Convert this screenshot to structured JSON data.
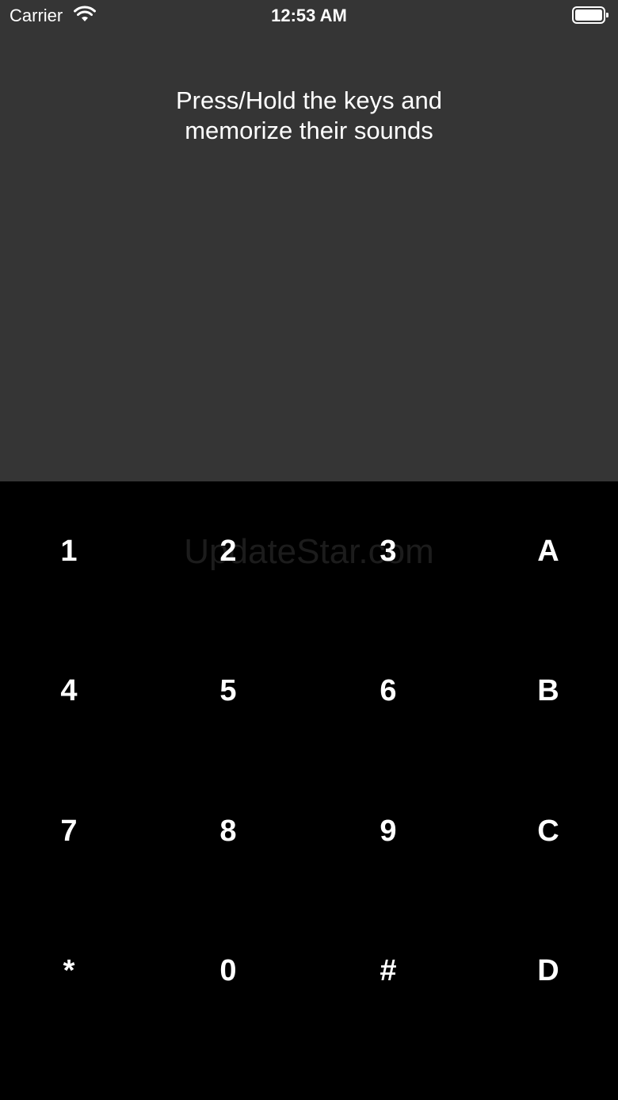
{
  "status_bar": {
    "carrier": "Carrier",
    "time": "12:53 AM",
    "wifi_icon": "wifi-icon",
    "battery_icon": "battery-icon"
  },
  "instruction": {
    "line1": "Press/Hold the keys and",
    "line2": "memorize their sounds"
  },
  "watermark": "UpdateStar.com",
  "keypad": {
    "keys": [
      {
        "label": "1"
      },
      {
        "label": "2"
      },
      {
        "label": "3"
      },
      {
        "label": "A"
      },
      {
        "label": "4"
      },
      {
        "label": "5"
      },
      {
        "label": "6"
      },
      {
        "label": "B"
      },
      {
        "label": "7"
      },
      {
        "label": "8"
      },
      {
        "label": "9"
      },
      {
        "label": "C"
      },
      {
        "label": "*"
      },
      {
        "label": "0"
      },
      {
        "label": "#"
      },
      {
        "label": "D"
      }
    ]
  },
  "colors": {
    "top_background": "#353535",
    "keypad_background": "#000000",
    "text": "#ffffff"
  }
}
